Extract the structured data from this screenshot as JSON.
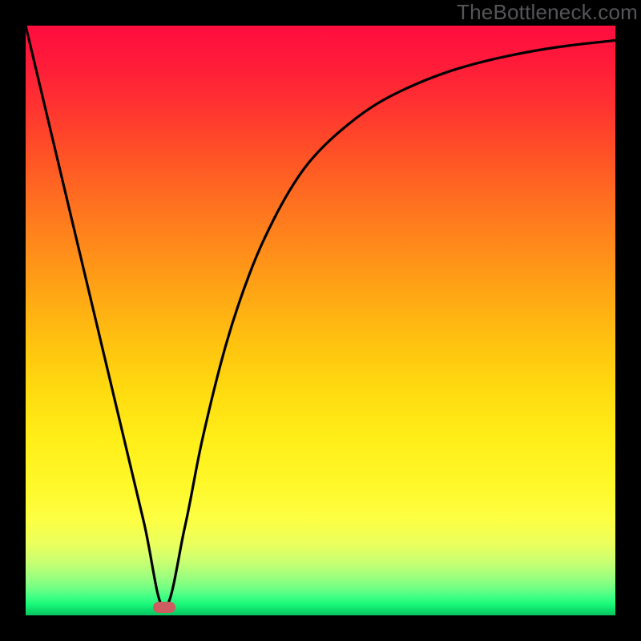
{
  "watermark": "TheBottleneck.com",
  "colors": {
    "curve": "#000000",
    "marker": "#cd5d60",
    "frame": "#000000"
  },
  "chart_data": {
    "type": "line",
    "title": "",
    "xlabel": "",
    "ylabel": "",
    "xlim": [
      0,
      100
    ],
    "ylim": [
      0,
      100
    ],
    "grid": false,
    "series": [
      {
        "name": "bottleneck-curve",
        "x": [
          0,
          5,
          10,
          15,
          20,
          23.5,
          27,
          30,
          34,
          38,
          42,
          46,
          50,
          55,
          60,
          66,
          72,
          78,
          85,
          92,
          100
        ],
        "y": [
          100,
          79,
          58,
          37,
          16,
          1.3,
          15,
          30,
          46,
          58,
          67,
          74,
          79,
          83.5,
          87,
          90,
          92.3,
          94,
          95.5,
          96.6,
          97.5
        ]
      }
    ],
    "marker": {
      "x": 23.5,
      "y": 1.3
    },
    "gradient_stops": [
      {
        "pos": 0,
        "color": "#ff0d3e"
      },
      {
        "pos": 50,
        "color": "#ffc310"
      },
      {
        "pos": 80,
        "color": "#fff82a"
      },
      {
        "pos": 100,
        "color": "#08c560"
      }
    ]
  }
}
